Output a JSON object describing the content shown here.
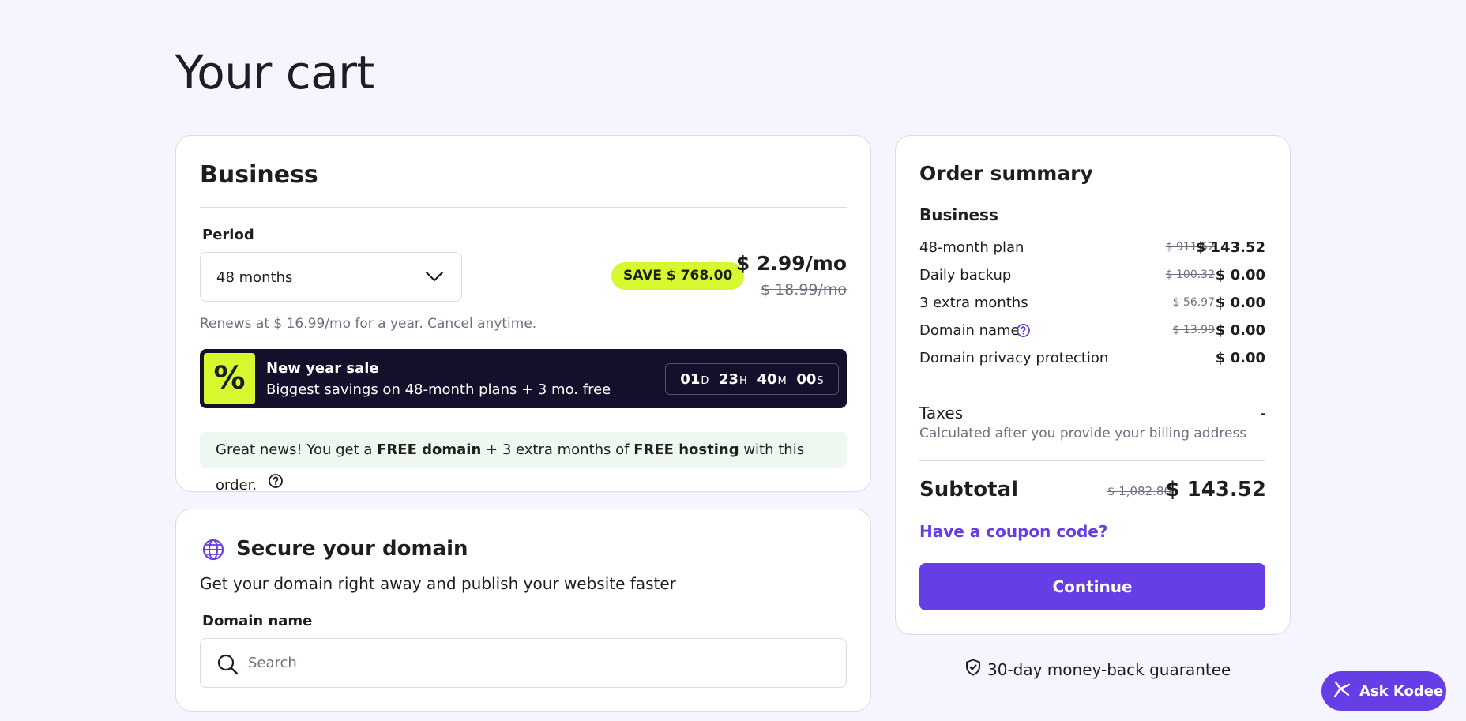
{
  "page": {
    "title": "Your cart"
  },
  "plan_card": {
    "title": "Business",
    "period_label": "Period",
    "period_value": "48 months",
    "save_badge": "SAVE $ 768.00",
    "price": "$ 2.99/mo",
    "price_old": "$ 18.99/mo",
    "renews_text": "Renews at $ 16.99/mo for a year. Cancel anytime.",
    "sale": {
      "badge": "%",
      "title": "New year sale",
      "description": "Biggest savings on 48-month plans + 3 mo. free",
      "countdown": {
        "days": "01",
        "days_unit": "D",
        "hours": "23",
        "hours_unit": "H",
        "minutes": "40",
        "minutes_unit": "M",
        "seconds": "00",
        "seconds_unit": "S"
      }
    },
    "free_notice": {
      "part1": "Great news! You get a ",
      "bold1": "FREE domain",
      "part2": " + 3 extra months of ",
      "bold2": "FREE hosting",
      "part3": " with this order."
    }
  },
  "domain_card": {
    "title": "Secure your domain",
    "subtitle": "Get your domain right away and publish your website faster",
    "field_label": "Domain name",
    "search_placeholder": "Search"
  },
  "summary": {
    "title": "Order summary",
    "plan_name": "Business",
    "items": [
      {
        "label": "48-month plan",
        "old": "$ 911.52",
        "new": "$ 143.52"
      },
      {
        "label": "Daily backup",
        "old": "$ 100.32",
        "new": "$ 0.00"
      },
      {
        "label": "3 extra months",
        "old": "$ 56.97",
        "new": "$ 0.00"
      },
      {
        "label": "Domain name",
        "old": "$ 13.99",
        "new": "$ 0.00"
      },
      {
        "label": "Domain privacy protection",
        "old": "",
        "new": "$ 0.00"
      }
    ],
    "taxes_label": "Taxes",
    "taxes_value": "-",
    "taxes_note": "Calculated after you provide your billing address",
    "subtotal_label": "Subtotal",
    "subtotal_old": "$ 1,082.80",
    "subtotal_new": "$ 143.52",
    "coupon_link": "Have a coupon code?",
    "continue_label": "Continue"
  },
  "guarantee": "30-day money-back guarantee",
  "chat_button": "Ask Kodee",
  "colors": {
    "accent": "#673de6",
    "highlight": "#d5f82e",
    "banner_dark": "#140f2b",
    "background": "#f4f5ff"
  }
}
